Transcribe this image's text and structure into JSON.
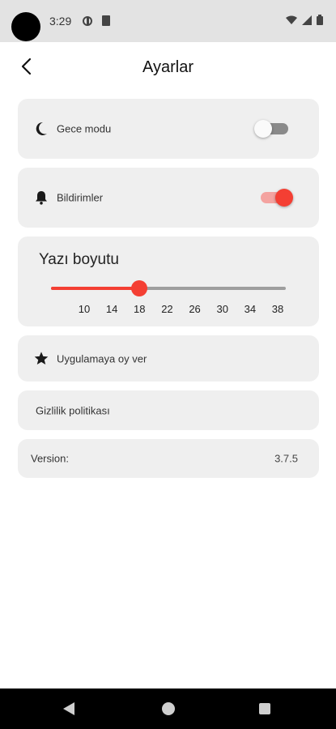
{
  "status_bar": {
    "time": "3:29"
  },
  "header": {
    "title": "Ayarlar",
    "back_icon": "chevron-left-icon"
  },
  "settings": {
    "night_mode": {
      "label": "Gece modu",
      "icon": "moon-icon",
      "enabled": false
    },
    "notifications": {
      "label": "Bildirimler",
      "icon": "bell-icon",
      "enabled": true
    },
    "font_size": {
      "title": "Yazı boyutu",
      "ticks": [
        "10",
        "14",
        "18",
        "22",
        "26",
        "30",
        "34",
        "38"
      ],
      "min": 10,
      "max": 38,
      "value": 18
    },
    "rate_app": {
      "label": "Uygulamaya oy ver",
      "icon": "star-icon"
    },
    "privacy": {
      "label": "Gizlilik politikası"
    },
    "version": {
      "label": "Version:",
      "value": "3.7.5"
    }
  },
  "colors": {
    "accent": "#f43f33",
    "card_bg": "#efefef",
    "status_bar_bg": "#e3e3e3"
  }
}
